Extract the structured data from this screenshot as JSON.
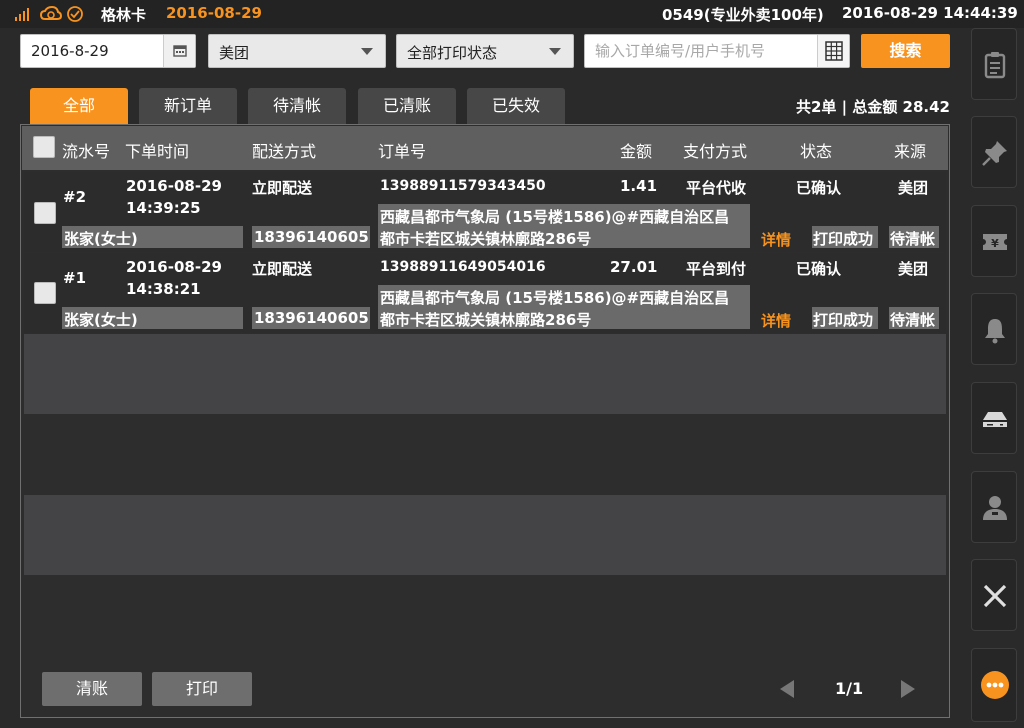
{
  "topbar": {
    "shop_name": "格林卡",
    "shop_date": "2016-08-29",
    "store_info": "0549(专业外卖100年)",
    "clock": "2016-08-29 14:44:39"
  },
  "filters": {
    "date": "2016-8-29",
    "platform": "美团",
    "print_status": "全部打印状态",
    "search_placeholder": "输入订单编号/用户手机号",
    "search_button": "搜索"
  },
  "tabs": [
    {
      "label": "全部",
      "active": true
    },
    {
      "label": "新订单"
    },
    {
      "label": "待清帐"
    },
    {
      "label": "已清账"
    },
    {
      "label": "已失效"
    }
  ],
  "summary": "共2单 | 总金额 28.42",
  "table": {
    "headers": {
      "serial": "流水号",
      "time": "下单时间",
      "delivery": "配送方式",
      "order_no": "订单号",
      "amount": "金额",
      "payment": "支付方式",
      "status": "状态",
      "source": "来源"
    },
    "rows": [
      {
        "serial": "#2",
        "date": "2016-08-29",
        "time": "14:39:25",
        "delivery": "立即配送",
        "order_no": "13988911579343450",
        "amount": "1.41",
        "payment": "平台代收",
        "status": "已确认",
        "source": "美团",
        "customer": "张家(女士)",
        "phone": "18396140605",
        "address_line1": "西藏昌都市气象局 (15号楼1586)@#西藏自治区昌",
        "address_line2": "都市卡若区城关镇林廓路286号",
        "detail": "详情",
        "print_result": "打印成功",
        "settle": "待清帐"
      },
      {
        "serial": "#1",
        "date": "2016-08-29",
        "time": "14:38:21",
        "delivery": "立即配送",
        "order_no": "13988911649054016",
        "amount": "27.01",
        "payment": "平台到付",
        "status": "已确认",
        "source": "美团",
        "customer": "张家(女士)",
        "phone": "18396140605",
        "address_line1": "西藏昌都市气象局 (15号楼1586)@#西藏自治区昌",
        "address_line2": "都市卡若区城关镇林廓路286号",
        "detail": "详情",
        "print_result": "打印成功",
        "settle": "待清帐"
      }
    ]
  },
  "bottom": {
    "settle_button": "清账",
    "print_button": "打印",
    "page": "1/1"
  },
  "sidebar": {
    "icons": [
      "clipboard-icon",
      "pin-icon",
      "ticket-icon",
      "bell-icon",
      "printer-icon",
      "user-icon",
      "close-icon",
      "more-icon"
    ]
  },
  "colors": {
    "accent": "#f7931e",
    "background": "#2a2a2a",
    "header_bg": "#5f5f5f"
  }
}
